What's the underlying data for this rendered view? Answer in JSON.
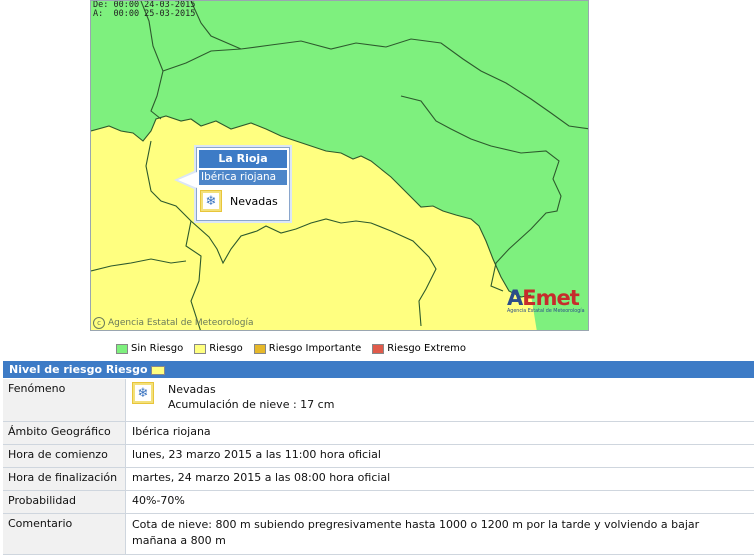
{
  "map": {
    "date_from": "De: 00:00 24-03-2015",
    "date_to": "A:  00:00 25-03-2015",
    "credit": "Agencia Estatal de Meteorología",
    "logo_mark_a": "A",
    "logo_mark_e": "Emet",
    "logo_sub": "Agencia Estatal de Meteorología",
    "colors": {
      "green": "#7ef07e",
      "yellow": "#ffff80",
      "border": "#2d5a2d"
    }
  },
  "popup": {
    "region": "La Rioja",
    "zone": "Ibérica riojana",
    "phenomenon": "Nevadas",
    "icon": "snowflake-icon"
  },
  "legend": [
    {
      "label": "Sin Riesgo",
      "color": "#7ef07e"
    },
    {
      "label": "Riesgo",
      "color": "#ffff80"
    },
    {
      "label": "Riesgo Importante",
      "color": "#e6b829"
    },
    {
      "label": "Riesgo Extremo",
      "color": "#e05a4a"
    }
  ],
  "header": {
    "title": "Nivel de riesgo Riesgo",
    "level_color": "#ffff80"
  },
  "table": {
    "fenomeno": {
      "label": "Fenómeno",
      "name": "Nevadas",
      "detail": "Acumulación de nieve : 17 cm"
    },
    "ambito": {
      "label": "Ámbito Geográfico",
      "value": "Ibérica riojana"
    },
    "comienzo": {
      "label": "Hora de comienzo",
      "value": "lunes, 23 marzo 2015 a las 11:00 hora oficial"
    },
    "finalizacion": {
      "label": "Hora de finalización",
      "value": "martes, 24 marzo 2015 a las 08:00 hora oficial"
    },
    "probabilidad": {
      "label": "Probabilidad",
      "value": "40%-70%"
    },
    "comentario": {
      "label": "Comentario",
      "line1": "Cota de nieve: 800 m subiendo pregresivamente hasta 1000 o 1200 m por la tarde y volviendo a bajar",
      "line2": "mañana a 800 m"
    }
  }
}
